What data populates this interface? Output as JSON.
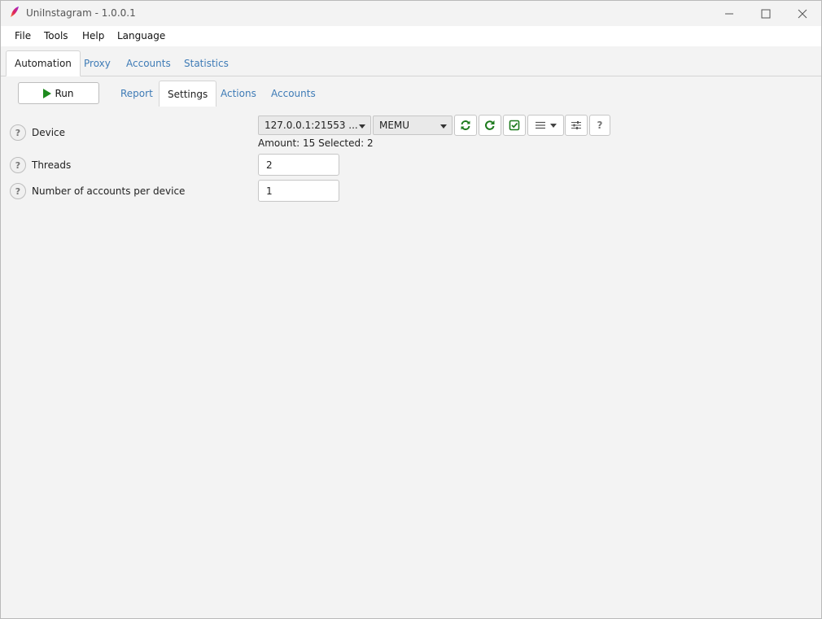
{
  "window": {
    "title": "UniInstagram - 1.0.0.1",
    "icon": "feather-icon",
    "accent_color": "#3e7bb6"
  },
  "menu": {
    "items": [
      "File",
      "Tools",
      "Help",
      "Language"
    ]
  },
  "tabs": [
    {
      "label": "Automation",
      "active": true
    },
    {
      "label": "Proxy",
      "active": false
    },
    {
      "label": "Accounts",
      "active": false
    },
    {
      "label": "Statistics",
      "active": false
    }
  ],
  "toolbar": {
    "run_label": "Run",
    "run_icon": "play-icon",
    "run_color": "#1d8a1d"
  },
  "subtabs": [
    {
      "label": "Report",
      "active": false
    },
    {
      "label": "Settings",
      "active": true
    },
    {
      "label": "Actions",
      "active": false
    },
    {
      "label": "Accounts",
      "active": false
    }
  ],
  "settings": {
    "device": {
      "label": "Device",
      "device_select": "127.0.0.1:21553 ...",
      "emulator_select": "MEMU",
      "amount_text": "Amount: 15  Selected: 2",
      "tools": [
        "sync-icon",
        "refresh-icon",
        "check-square-icon",
        "list-menu-icon",
        "sliders-icon",
        "help-icon"
      ]
    },
    "threads": {
      "label": "Threads",
      "value": "2"
    },
    "accounts_per_device": {
      "label": "Number of accounts per device",
      "value": "1"
    },
    "help_glyph": "?"
  }
}
